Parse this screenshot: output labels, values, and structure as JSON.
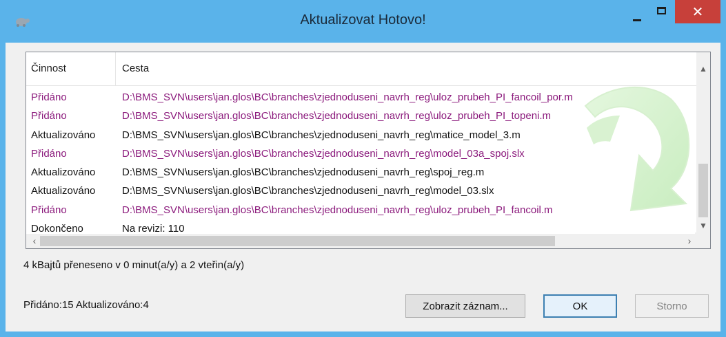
{
  "window": {
    "title": "Aktualizovat Hotovo!",
    "close_glyph": "✕"
  },
  "list": {
    "columns": [
      "Činnost",
      "Cesta"
    ],
    "rows": [
      {
        "action": "Přidáno",
        "path": "D:\\BMS_SVN\\users\\jan.glos\\BC\\branches\\zjednoduseni_navrh_reg\\uloz_prubeh_PI_fancoil_por.m",
        "kind": "added"
      },
      {
        "action": "Přidáno",
        "path": "D:\\BMS_SVN\\users\\jan.glos\\BC\\branches\\zjednoduseni_navrh_reg\\uloz_prubeh_PI_topeni.m",
        "kind": "added"
      },
      {
        "action": "Aktualizováno",
        "path": "D:\\BMS_SVN\\users\\jan.glos\\BC\\branches\\zjednoduseni_navrh_reg\\matice_model_3.m",
        "kind": "updated"
      },
      {
        "action": "Přidáno",
        "path": "D:\\BMS_SVN\\users\\jan.glos\\BC\\branches\\zjednoduseni_navrh_reg\\model_03a_spoj.slx",
        "kind": "added"
      },
      {
        "action": "Aktualizováno",
        "path": "D:\\BMS_SVN\\users\\jan.glos\\BC\\branches\\zjednoduseni_navrh_reg\\spoj_reg.m",
        "kind": "updated"
      },
      {
        "action": "Aktualizováno",
        "path": "D:\\BMS_SVN\\users\\jan.glos\\BC\\branches\\zjednoduseni_navrh_reg\\model_03.slx",
        "kind": "updated"
      },
      {
        "action": "Přidáno",
        "path": "D:\\BMS_SVN\\users\\jan.glos\\BC\\branches\\zjednoduseni_navrh_reg\\uloz_prubeh_PI_fancoil.m",
        "kind": "added"
      },
      {
        "action": "Dokončeno",
        "path": "Na revizi: 110",
        "kind": "done"
      }
    ]
  },
  "status": {
    "transfer": "4 kBajtů přeneseno v 0 minut(a/y) a 2 vteřin(a/y)",
    "summary": "Přidáno:15 Aktualizováno:4"
  },
  "buttons": {
    "show_log": "Zobrazit záznam...",
    "ok": "OK",
    "cancel": "Storno"
  },
  "colors": {
    "frame": "#5ab3ea",
    "added_text": "#8b1a7c",
    "updated_text": "#111111",
    "close_button": "#c7403a"
  },
  "icons": {
    "app": "tortoise-icon",
    "watermark": "update-arrow-icon",
    "scroll_up": "chevron-up-icon",
    "scroll_down": "chevron-down-icon",
    "scroll_left": "chevron-left-icon",
    "scroll_right": "chevron-right-icon"
  }
}
